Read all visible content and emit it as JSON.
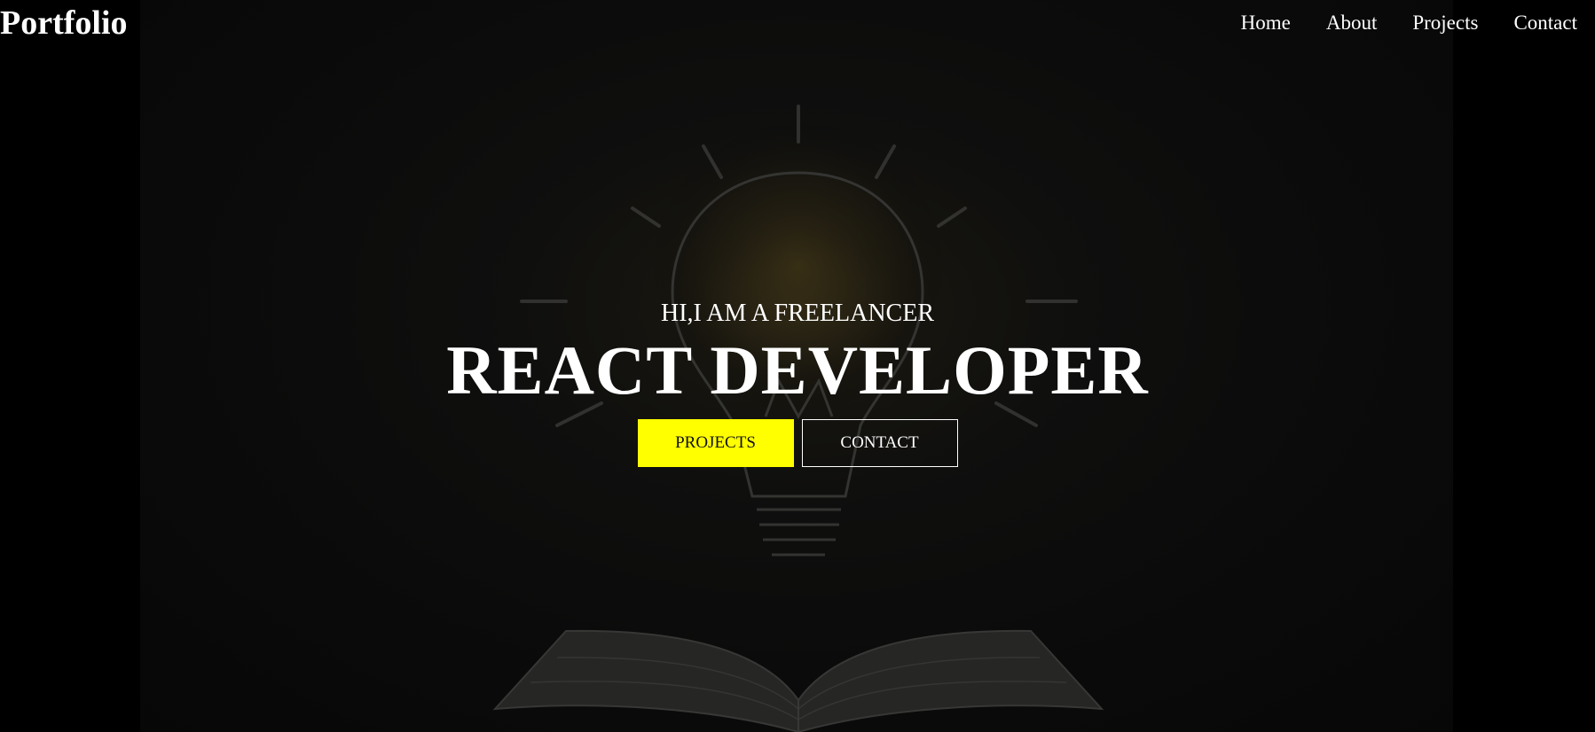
{
  "header": {
    "logo": "Portfolio",
    "nav": [
      {
        "label": "Home"
      },
      {
        "label": "About"
      },
      {
        "label": "Projects"
      },
      {
        "label": "Contact"
      }
    ]
  },
  "hero": {
    "subtitle": "HI,I AM A FREELANCER",
    "title": "REACT DEVELOPER",
    "buttons": {
      "projects": "PROJECTS",
      "contact": "CONTACT"
    },
    "background_image": "lightbulb-over-open-book-icon"
  },
  "colors": {
    "page_background": "#000000",
    "text": "#ffffff",
    "accent": "#ffff00"
  }
}
